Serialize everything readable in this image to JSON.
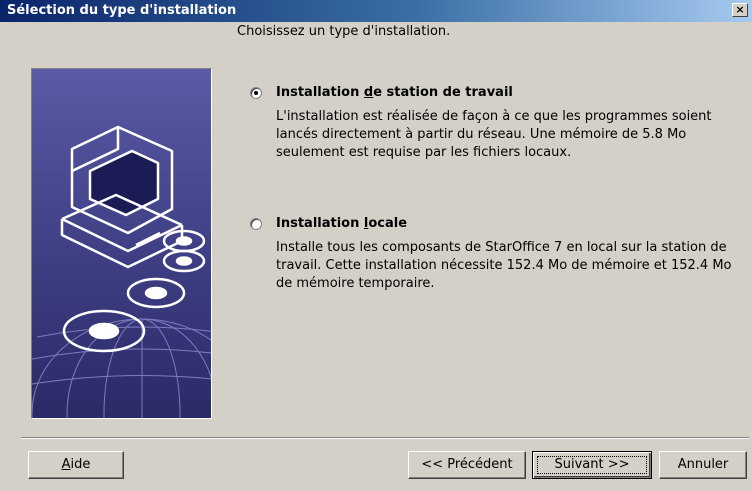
{
  "window": {
    "title": "Sélection du type d'installation",
    "close_label": "×"
  },
  "main": {
    "prompt": "Choisissez un type d'installation.",
    "options": [
      {
        "label_before": "Installation ",
        "label_accel": "d",
        "label_after": "e station de travail",
        "description": "L'installation est réalisée de façon à ce que les programmes soient lancés directement à partir du réseau. Une mémoire de 5.8 Mo seulement est requise par les fichiers locaux.",
        "selected": true
      },
      {
        "label_before": "Installation ",
        "label_accel": "l",
        "label_after": "ocale",
        "description": "Installe tous les composants de StarOffice 7 en local sur la station de travail. Cette installation nécessite 152.4 Mo de mémoire et 152.4 Mo de mémoire temporaire.",
        "selected": false
      }
    ]
  },
  "footer": {
    "help": {
      "accel": "A",
      "rest": "ide"
    },
    "back_label": "<< Précédent",
    "next_label": "Suivant >>",
    "cancel_label": "Annuler"
  },
  "colors": {
    "title_active": "#0a246a",
    "dialog_face": "#d4d0c8",
    "illustration_bg": "#4a4a8a"
  },
  "icons": [
    "close-icon",
    "computer-icon",
    "cd-icon",
    "globe-icon",
    "radio-selected-icon",
    "radio-unselected-icon"
  ]
}
